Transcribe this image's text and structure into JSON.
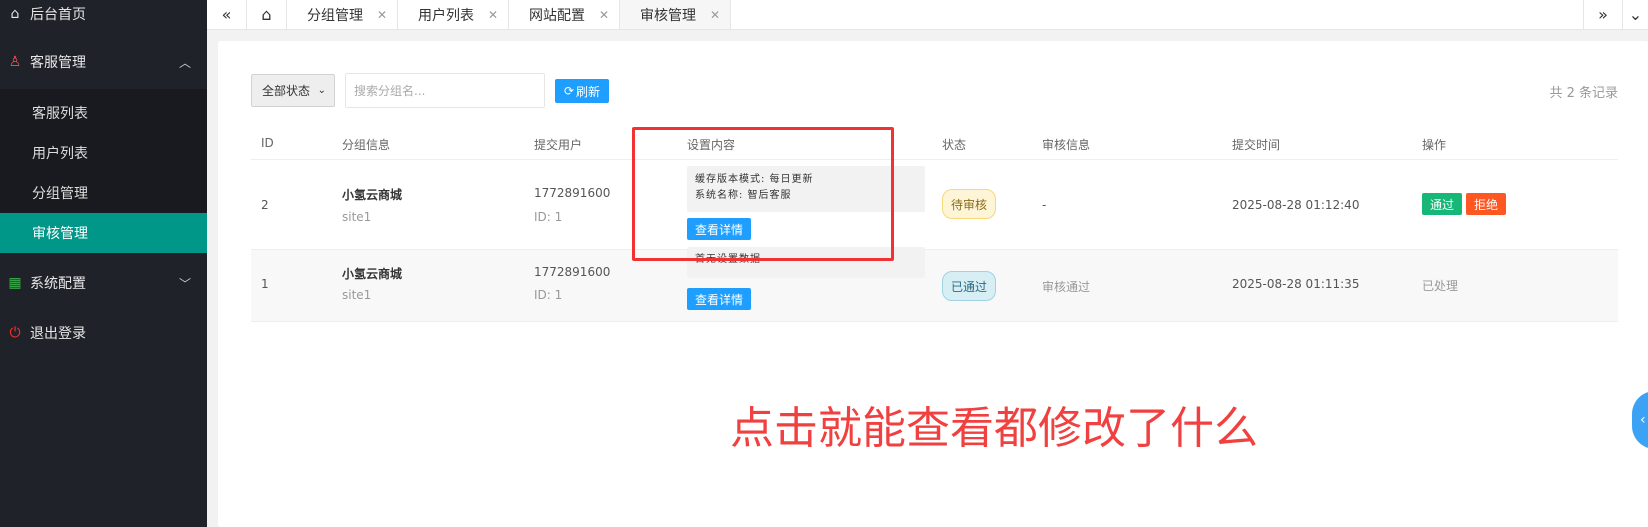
{
  "sidebar": {
    "home": {
      "label": "后台首页",
      "icon": "home-icon"
    },
    "cs": {
      "label": "客服管理",
      "icon": "user-icon",
      "expanded": true
    },
    "sub": [
      {
        "label": "客服列表"
      },
      {
        "label": "用户列表"
      },
      {
        "label": "分组管理"
      },
      {
        "label": "审核管理",
        "active": true
      }
    ],
    "sys": {
      "label": "系统配置",
      "icon": "grid-icon"
    },
    "logout": {
      "label": "退出登录",
      "icon": "power-icon"
    }
  },
  "tabs": {
    "items": [
      {
        "label": "分组管理"
      },
      {
        "label": "用户列表"
      },
      {
        "label": "网站配置"
      },
      {
        "label": "审核管理",
        "active": true
      }
    ]
  },
  "toolbar": {
    "status_select": "全部状态",
    "search_placeholder": "搜索分组名...",
    "refresh_label": "刷新",
    "total": "共 2 条记录"
  },
  "table": {
    "headers": [
      "ID",
      "分组信息",
      "提交用户",
      "设置内容",
      "状态",
      "审核信息",
      "提交时间",
      "操作"
    ],
    "rows": [
      {
        "id": "2",
        "group_name": "小氢云商城",
        "group_site": "site1",
        "user": "1772891600",
        "user_id": "ID: 1",
        "content_line1": "缓存版本模式: 每日更新",
        "content_line2": "系统名称: 智后客服",
        "detail_label": "查看详情",
        "status": "待审核",
        "review_info": "-",
        "time": "2025-08-28 01:12:40",
        "approve_label": "通过",
        "reject_label": "拒绝"
      },
      {
        "id": "1",
        "group_name": "小氢云商城",
        "group_site": "site1",
        "user": "1772891600",
        "user_id": "ID: 1",
        "content_line1": "首无设置数据",
        "detail_label": "查看详情",
        "status": "已通过",
        "review_info": "审核通过",
        "time": "2025-08-28 01:11:35",
        "action_text": "已处理"
      }
    ]
  },
  "annotation": "点击就能查看都修改了什么",
  "colors": {
    "sidebar_bg": "#20222a",
    "active_teal": "#009688",
    "primary_blue": "#1e9fff",
    "approve_green": "#16b777",
    "reject_red": "#ff5722",
    "annotation_red": "#f04040"
  }
}
